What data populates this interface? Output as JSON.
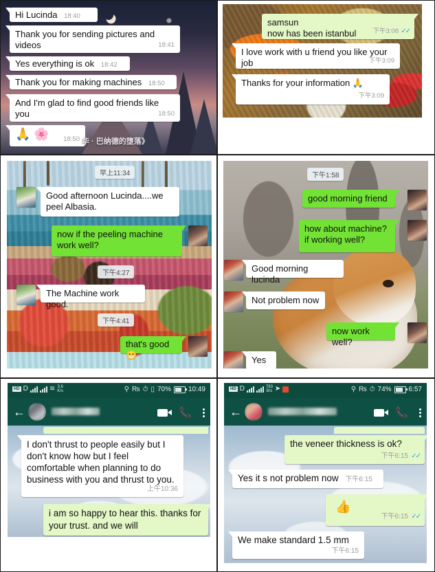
{
  "panels": [
    {
      "id": "p1",
      "name": "chat-night-wallpaper",
      "overlay_text": "华 · 巴纳德的堕落》",
      "messages": [
        {
          "side": "in",
          "text": "Hi Lucinda",
          "time": "18:40"
        },
        {
          "side": "in",
          "text": "Thank you for sending pictures and videos",
          "time": "18:41"
        },
        {
          "side": "in",
          "text": "Yes everything is ok",
          "time": "18:42"
        },
        {
          "side": "in",
          "text": "Thank you for making machines",
          "time": "18:50"
        },
        {
          "side": "in",
          "text": "And I'm glad to find good friends like you",
          "time": "18:50"
        },
        {
          "side": "in",
          "text": "🙏 🌸",
          "time": "18:50",
          "emoji": true
        }
      ]
    },
    {
      "id": "p2",
      "name": "chat-food-wallpaper",
      "messages": [
        {
          "side": "out",
          "text": "samsun\nnow has been istanbul",
          "time": "下午3:08",
          "ticks": true
        },
        {
          "side": "in",
          "text": "I love work with u friend you like your job",
          "time": "下午3:09"
        },
        {
          "side": "in",
          "text": "Thanks for your information 🙏",
          "time": "下午3:09"
        }
      ]
    },
    {
      "id": "p3",
      "name": "chat-resort-wallpaper",
      "day_pills": [
        "早上11:34",
        "下午4:27",
        "下午4:41"
      ],
      "messages": [
        {
          "side": "in",
          "text": "Good afternoon Lucinda....we peel Albasia.",
          "avatar": "man-avatar"
        },
        {
          "side": "out",
          "text": "now if the peeling machine work well?",
          "avatar": "woman-avatar"
        },
        {
          "side": "in",
          "text": "The Machine work good.",
          "avatar": "man-avatar"
        },
        {
          "side": "out",
          "text": "that's good 😁",
          "avatar": "woman-avatar"
        }
      ]
    },
    {
      "id": "p4",
      "name": "chat-dog-wallpaper",
      "day_pills": [
        "下午1:58"
      ],
      "messages": [
        {
          "side": "out",
          "text": "good morning friend",
          "avatar": "woman-avatar"
        },
        {
          "side": "out",
          "text": "how about machine?\nif working well?",
          "avatar": "woman-avatar"
        },
        {
          "side": "in",
          "text": "Good morning lucinda",
          "avatar": "man2-avatar"
        },
        {
          "side": "in",
          "text": "Not problem now",
          "avatar": "man2-avatar"
        },
        {
          "side": "out",
          "text": "now work well?",
          "avatar": "woman-avatar"
        },
        {
          "side": "in",
          "text": "Yes",
          "avatar": "man2-avatar"
        }
      ]
    },
    {
      "id": "p5",
      "name": "whatsapp-screenshot-trust",
      "statusbar": {
        "network": "HD",
        "speed_value": "3.6",
        "speed_unit": "K/s",
        "battery": "70%",
        "clock": "10:49"
      },
      "appbar": {
        "contact_name": "",
        "back": "back-arrow"
      },
      "messages": [
        {
          "side": "in",
          "text": "I don't thrust to people easily but I  don't know how but I feel comfortable when planning to do business with you and thrust to you.",
          "time": "上午10:36"
        },
        {
          "side": "outpale",
          "text": "i am so happy to hear this. thanks for your trust. and we will"
        }
      ]
    },
    {
      "id": "p6",
      "name": "whatsapp-screenshot-veneer",
      "statusbar": {
        "network": "HD",
        "speed_value": "783",
        "speed_unit": "B/s",
        "battery": "74%",
        "clock": "6:57"
      },
      "appbar": {
        "contact_name": "",
        "back": "back-arrow"
      },
      "messages": [
        {
          "side": "outpale",
          "text": "the veneer thickness is ok?",
          "time": "下午6:15",
          "ticks": true
        },
        {
          "side": "in",
          "text": "Yes it s not problem now",
          "time": "下午6:15"
        },
        {
          "side": "outpale",
          "text": "👍",
          "time": "下午6:15",
          "ticks": true,
          "emoji": true
        },
        {
          "side": "in",
          "text": "We make standard 1.5 mm",
          "time": "下午6:15"
        }
      ]
    }
  ],
  "colors": {
    "bubble_in": "#ffffff",
    "bubble_out_bright": "#72e335",
    "bubble_out_pale": "#e4f7c7",
    "whatsapp_header": "#0f5045",
    "statusbar": "#0d4b3f",
    "tick_blue": "#3aa0e8",
    "time_grey": "#9b9b9b"
  },
  "icons": {
    "video_call": "video-camera-icon",
    "voice_call": "phone-icon",
    "overflow": "three-dots-menu-icon",
    "back": "back-arrow-icon",
    "ticks": "double-check-icon",
    "key": "vpn-key-icon",
    "alarm": "alarm-icon",
    "vibrate": "vibrate-icon",
    "wifi": "wifi-icon",
    "signal": "signal-bars-icon",
    "battery": "battery-icon"
  }
}
